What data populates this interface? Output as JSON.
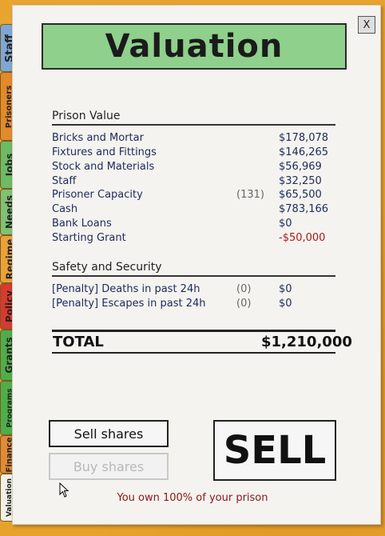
{
  "tabs": [
    {
      "label": "Staff",
      "color": "#7ea7d4"
    },
    {
      "label": "Prisoners",
      "color": "#e38a2a"
    },
    {
      "label": "Jobs",
      "color": "#6dbb64"
    },
    {
      "label": "Needs",
      "color": "#7fc274"
    },
    {
      "label": "Regime",
      "color": "#e9a23a"
    },
    {
      "label": "Policy",
      "color": "#d83a2e"
    },
    {
      "label": "Grants",
      "color": "#4fae4a"
    },
    {
      "label": "Programs",
      "color": "#4fae4a"
    },
    {
      "label": "Finance",
      "color": "#e28a36"
    },
    {
      "label": "Valuation",
      "color": "#f3f0e6"
    }
  ],
  "close_label": "X",
  "title": "Valuation",
  "prison_value": {
    "heading": "Prison Value",
    "rows": [
      {
        "label": "Bricks and Mortar",
        "count": "",
        "value": "$178,078"
      },
      {
        "label": "Fixtures and Fittings",
        "count": "",
        "value": "$146,265"
      },
      {
        "label": "Stock and Materials",
        "count": "",
        "value": "$56,969"
      },
      {
        "label": "Staff",
        "count": "",
        "value": "$32,250"
      },
      {
        "label": "Prisoner Capacity",
        "count": "(131)",
        "value": "$65,500"
      },
      {
        "label": "Cash",
        "count": "",
        "value": "$783,166"
      },
      {
        "label": "Bank Loans",
        "count": "",
        "value": "$0"
      },
      {
        "label": "Starting Grant",
        "count": "",
        "value": "-$50,000"
      }
    ]
  },
  "safety": {
    "heading": "Safety and Security",
    "rows": [
      {
        "label": "[Penalty] Deaths in past 24h",
        "count": "(0)",
        "value": "$0"
      },
      {
        "label": "[Penalty] Escapes in past 24h",
        "count": "(0)",
        "value": "$0"
      }
    ]
  },
  "total": {
    "label": "TOTAL",
    "value": "$1,210,000"
  },
  "buttons": {
    "sell_shares": "Sell shares",
    "buy_shares": "Buy shares",
    "sell": "SELL"
  },
  "ownership_text": "You own 100% of your prison"
}
